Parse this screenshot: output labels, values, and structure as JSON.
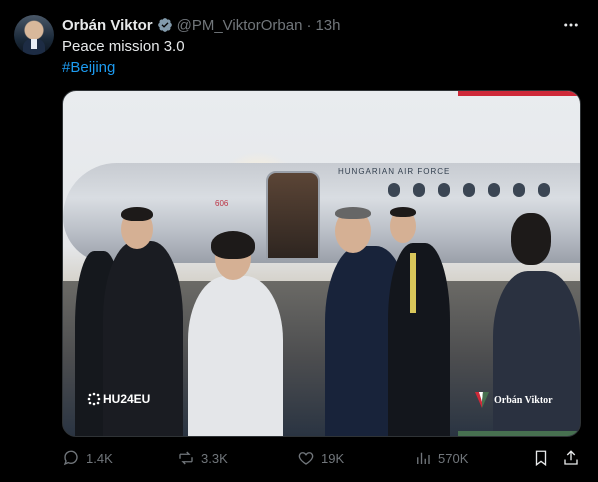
{
  "author": {
    "name": "Orbán Viktor",
    "handle": "@PM_ViktorOrban",
    "separator": "·",
    "time": "13h"
  },
  "tweet": {
    "text": "Peace mission 3.0",
    "hashtag": "#Beijing"
  },
  "media": {
    "plane_label": "HUNGARIAN AIR FORCE",
    "plane_number": "606",
    "watermark_left": "HU24EU",
    "watermark_right": "Orbán Viktor"
  },
  "actions": {
    "replies": "1.4K",
    "reposts": "3.3K",
    "likes": "19K",
    "views": "570K"
  },
  "icons": {
    "verified": "verified-badge-icon",
    "more": "more-options-icon",
    "reply": "reply-icon",
    "repost": "repost-icon",
    "like": "heart-icon",
    "views": "views-chart-icon",
    "bookmark": "bookmark-icon",
    "share": "share-icon"
  },
  "colors": {
    "background": "#000000",
    "text": "#e7e9ea",
    "secondary": "#71767b",
    "link": "#1d9bf0",
    "flag_red": "#ce2939",
    "flag_green": "#477050"
  }
}
